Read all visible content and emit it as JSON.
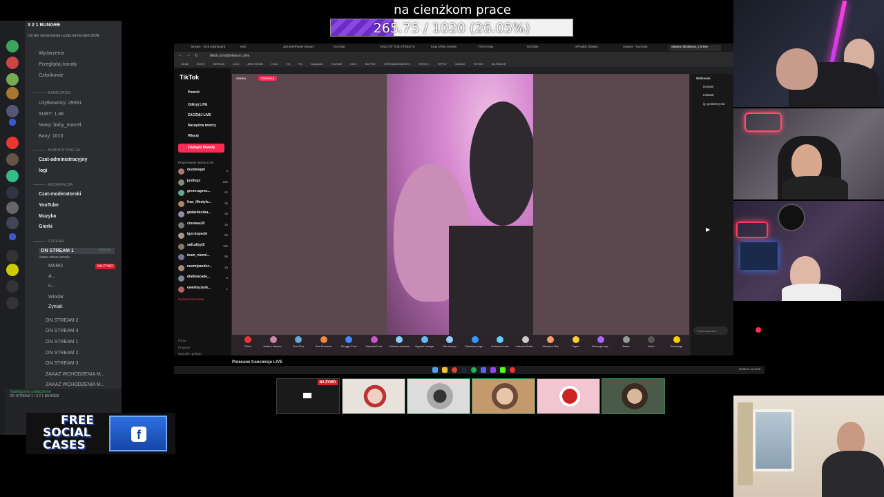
{
  "goal": {
    "title": "na cienżkom prace",
    "progress_text": "265.75 / 1020 (26.05%)",
    "progress_fraction": 0.2605,
    "fill_color": "#7b3bd6"
  },
  "discord": {
    "server_name": "3 2 1 BUNGEE",
    "subtitle": "Cel dol. wzmocnienia Liczba wzmocnień 22/28",
    "menu": [
      "Wydarzenia",
      "Przeglądaj kanały",
      "Członkowie"
    ],
    "cat_banderski": "BANDURSKI",
    "stats": [
      "Użytkownicy: 29061",
      "SUBY: 1.4K",
      "Nowy: baby_marcel.",
      "Bany: 1010"
    ],
    "cat_admin": "ADMINISTRACJA",
    "admin_channels": [
      "Czat-administracyjny",
      "logi"
    ],
    "cat_mod": "MODERACJA",
    "mod_channels": [
      "Czat-moderatorski",
      "YouTube",
      "Muzyka",
      "Gierki"
    ],
    "cat_stream": "STREAM",
    "stream_active": "ON STREAM 1",
    "stream_active_time": "6:21:11",
    "stream_status": "Ustaw status kanału",
    "voice_users": [
      "MARO",
      "A...",
      "n...",
      "Wiodar",
      "Zyniak"
    ],
    "live_badge": "NA ŻYWO",
    "stream_channels": [
      "ON STREAM 2",
      "ON STREAM 3",
      "ON STREAM 1",
      "ON STREAM 2",
      "ON STREAM 3",
      "ZAKAZ WCHODZENIA M...",
      "ZAKAZ WCHODZENIA M..."
    ],
    "voice_status": "Nawiązano połączenie",
    "voice_channel": "ON STREAM 1 / 3 2 1 BUNGEE"
  },
  "ad": {
    "line1": "FREE",
    "line2": "SOCIAL",
    "line3": "CASES"
  },
  "browser": {
    "tabs": [
      "Stream - Kick Dashboard",
      "Kick",
      "admin@Pixele Stream",
      "YouTube",
      "KING OF THE STREETS",
      "King of the Streets",
      "YOO Kings",
      "YouTube",
      "UPADEK Zbysko",
      "zwspot - YouTube",
      "oliaska (@oliwson_) is live"
    ],
    "url": "tiktok.com/@oliwson_/live",
    "bookmarks": [
      "Gmail",
      "DOCS",
      "WERSJA",
      "LOGI",
      "ARCHIWUM",
      "KCM",
      "TIK",
      "FB",
      "Instagram",
      "YouTube",
      "KICK",
      "BOTRIX",
      "STREAMELEMENTS",
      "TWITCH",
      "TIPPLY",
      "KAKAO",
      "TIKTOK",
      "NA HIBICIE"
    ]
  },
  "tiktok": {
    "logo": "TikTok",
    "nav": [
      "Powrót",
      "Odkryj LIVE",
      "ZACZNIJ LIVE",
      "Narzędzia twórcy",
      "Więcej"
    ],
    "coins_button": "Zdobądź Monety",
    "suggested_label": "Proponowani twórcy LIVE",
    "creators": [
      {
        "name": "dudekwgm",
        "count": "3"
      },
      {
        "name": "justingx",
        "count": "295"
      },
      {
        "name": "green.agenc...",
        "count": "44"
      },
      {
        "name": "fran_lifestyle...",
        "count": "16"
      },
      {
        "name": "gwiazdeczka...",
        "count": "19"
      },
      {
        "name": "cinowas30",
        "count": "16"
      },
      {
        "name": "igor.kopecki",
        "count": "35"
      },
      {
        "name": "safi.aliyyi2",
        "count": "110"
      },
      {
        "name": "team_niezni...",
        "count": "96"
      },
      {
        "name": "naomipandor...",
        "count": "16"
      },
      {
        "name": "diabloacade...",
        "count": "9"
      },
      {
        "name": "ewelina.bork...",
        "count": "1"
      }
    ],
    "see_all": "Wyświetl wszystko",
    "footer": [
      "Firma",
      "Program",
      "Warunki i polityki",
      "© 2025 TikTok"
    ],
    "host": "oliaska",
    "follow": "Obserwuj",
    "gifts": [
      "Róża",
      "Jestem stream...",
      "Fest Pop",
      "Sen Rumidor",
      "Okrągły Ford",
      "Kapsuła Ford",
      "Chińska wolność",
      "Ogarek Amega",
      "Sila drużyn",
      "Zwiadowy kąp...",
      "Królowa Lucia",
      "Lodowa Korte...",
      "Mocarna Mia",
      "Super",
      "Zatoczyło się...",
      "Bawa",
      "More",
      "Recharge"
    ],
    "viewers_label": "Widzowie",
    "viewers": [
      "Damian",
      "Kuba68",
      "ig: grobolnyy.63"
    ],
    "comment_placeholder": "Komentarz też...",
    "recommended": "Polecane transmisje LIVE"
  },
  "taskbar": {
    "time": "00:00",
    "date": "21.11.2025"
  },
  "thumbnails": {
    "live_badge": "NA ŻYWO"
  }
}
